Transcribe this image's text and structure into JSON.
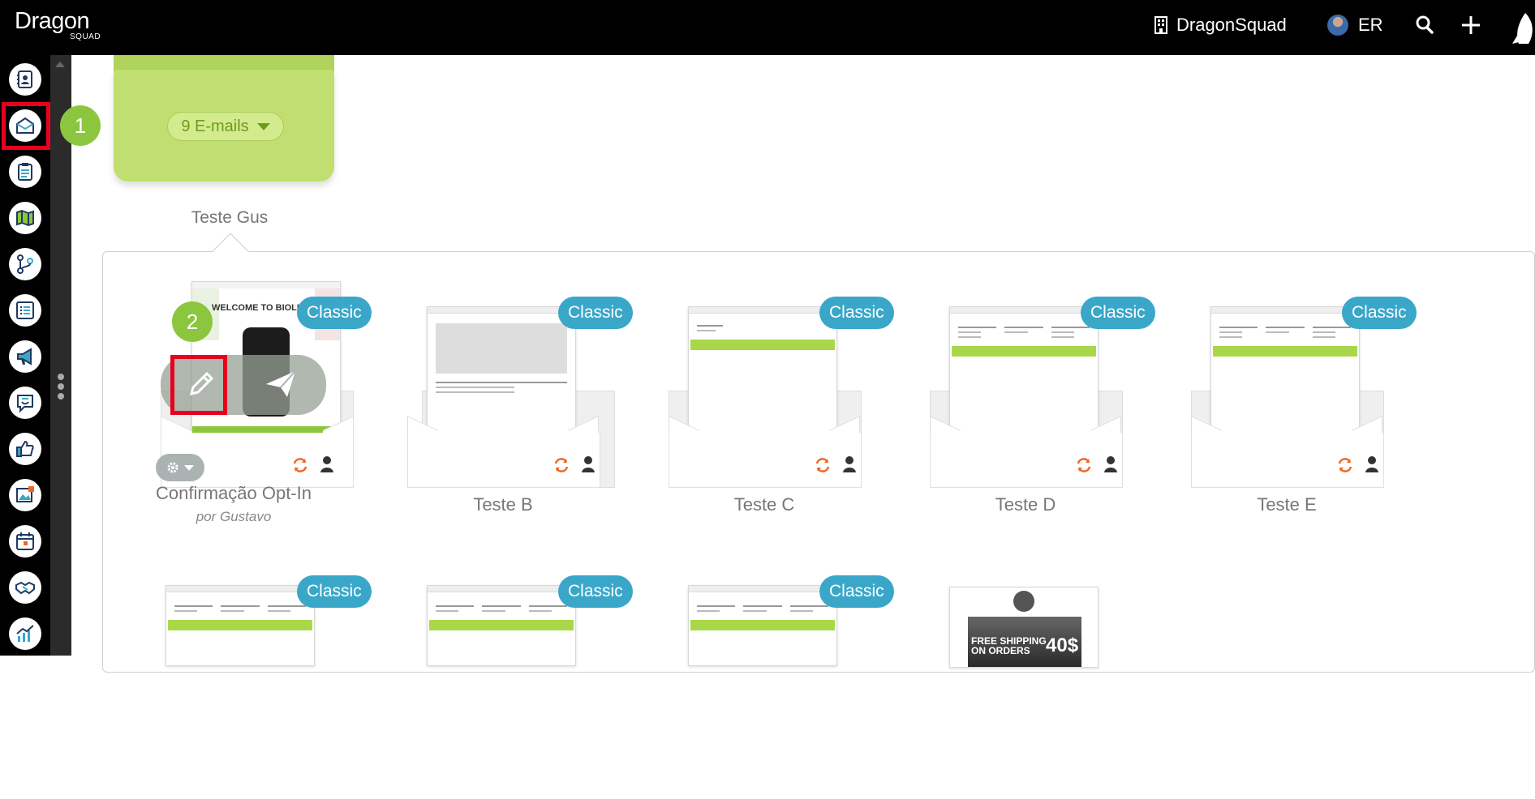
{
  "topbar": {
    "logo_word": "Dragon",
    "logo_sub": "SQUAD",
    "company": "DragonSquad",
    "user_initials": "ER"
  },
  "sidebar": {
    "items": [
      {
        "name": "contacts-icon"
      },
      {
        "name": "email-icon"
      },
      {
        "name": "forms-icon"
      },
      {
        "name": "map-icon"
      },
      {
        "name": "flow-icon"
      },
      {
        "name": "list-icon"
      },
      {
        "name": "megaphone-icon"
      },
      {
        "name": "chat-icon"
      },
      {
        "name": "thumbs-up-icon"
      },
      {
        "name": "image-icon"
      },
      {
        "name": "calendar-icon"
      },
      {
        "name": "handshake-icon"
      },
      {
        "name": "analytics-icon"
      }
    ]
  },
  "steps": {
    "one": "1",
    "two": "2"
  },
  "folder": {
    "count_label": "9 E-mails",
    "name": "Teste Gus"
  },
  "emails": [
    {
      "title": "Confirmação Opt-In",
      "author": "por Gustavo",
      "badge": "Classic",
      "thumb_header": "WELCOME TO BIOLIFE"
    },
    {
      "title": "Teste B",
      "badge": "Classic"
    },
    {
      "title": "Teste C",
      "badge": "Classic"
    },
    {
      "title": "Teste D",
      "badge": "Classic"
    },
    {
      "title": "Teste E",
      "badge": "Classic"
    },
    {
      "badge": "Classic"
    },
    {
      "badge": "Classic"
    },
    {
      "badge": "Classic"
    },
    {
      "thumb_promo_main": "FREE SHIPPING",
      "thumb_promo_sub": "ON ORDERS",
      "thumb_promo_amount": "40$"
    }
  ],
  "colors": {
    "accent_green": "#8cc63f",
    "badge_blue": "#3aa7c9",
    "highlight_red": "#e8001c",
    "sync_orange": "#f26522"
  }
}
